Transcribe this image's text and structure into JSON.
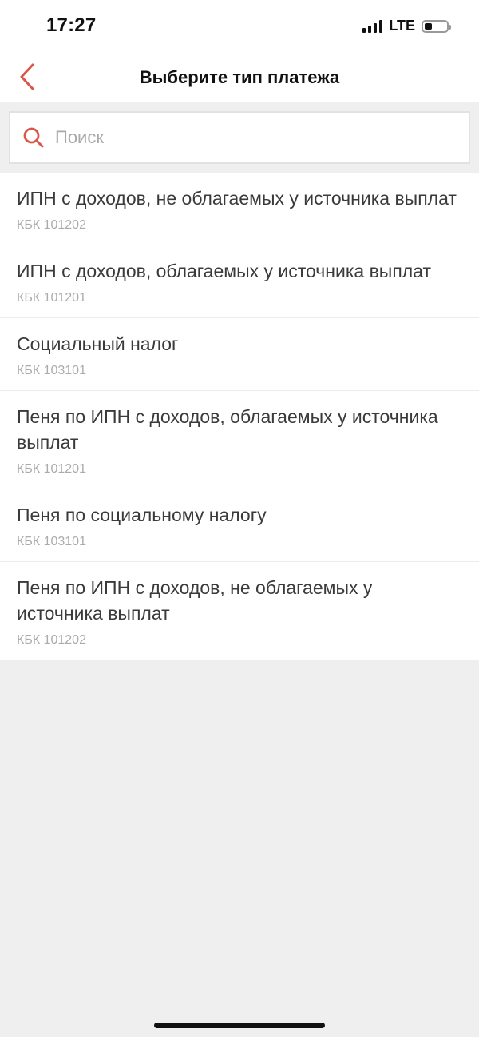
{
  "status_bar": {
    "time": "17:27",
    "network": "LTE",
    "battery_level": 0.35,
    "signal_bars": 4
  },
  "nav": {
    "title": "Выберите тип платежа",
    "back_icon": "chevron-left-icon"
  },
  "search": {
    "placeholder": "Поиск",
    "value": "",
    "icon": "search-icon"
  },
  "items": [
    {
      "title": "ИПН с доходов, не облагаемых у источника выплат",
      "code": "КБК 101202"
    },
    {
      "title": "ИПН с доходов, облагаемых у источника выплат",
      "code": "КБК 101201"
    },
    {
      "title": "Социальный налог",
      "code": "КБК 103101"
    },
    {
      "title": "Пеня по ИПН с доходов, облагаемых у источника выплат",
      "code": "КБК 101201"
    },
    {
      "title": "Пеня по социальному налогу",
      "code": "КБК 103101"
    },
    {
      "title": "Пеня по ИПН с доходов, не облагаемых у источника выплат",
      "code": "КБК 101202"
    }
  ],
  "colors": {
    "accent": "#d9574a",
    "background": "#efefef",
    "text": "#3a3a3a",
    "muted": "#ababab"
  }
}
